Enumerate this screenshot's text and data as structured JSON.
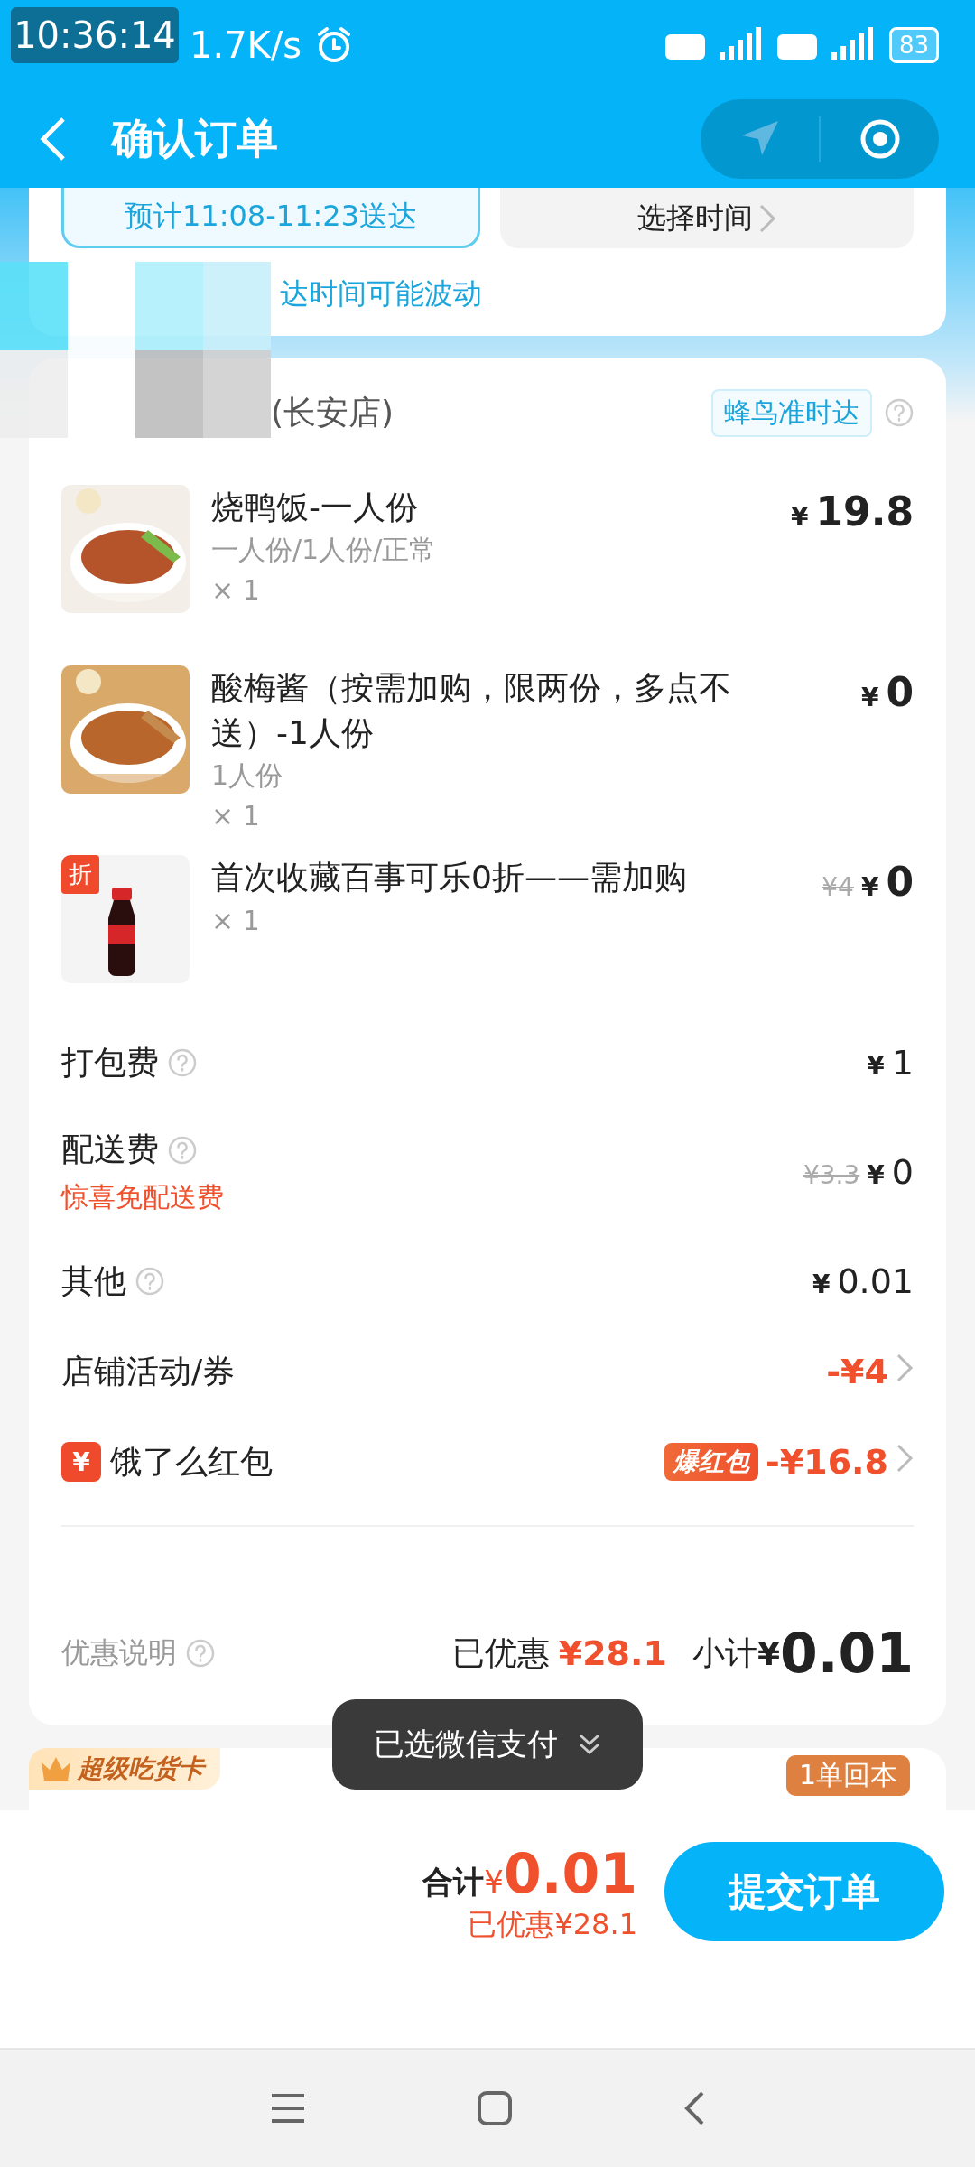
{
  "status_bar": {
    "overlay_time": "10:36:14",
    "speed": "1.7K/s",
    "battery": "83"
  },
  "header": {
    "title": "确认订单"
  },
  "delivery": {
    "options": [
      {
        "label": "预计11:08-11:23送达",
        "selected": true
      },
      {
        "label": "选择时间",
        "selected": false
      }
    ],
    "note": "达时间可能波动"
  },
  "store": {
    "name": "(长安店)",
    "badge": "蜂鸟准时达"
  },
  "items": [
    {
      "name": "烧鸭饭-一人份",
      "spec": "一人份/1人份/正常",
      "qty": "× 1",
      "currency": "¥",
      "price": "19.8"
    },
    {
      "name": "酸梅酱（按需加购，限两份，多点不送）-1人份",
      "spec": "1人份",
      "qty": "× 1",
      "currency": "¥",
      "price": "0"
    },
    {
      "name": "首次收藏百事可乐0折——需加购",
      "qty": "× 1",
      "tag": "折",
      "original_price": "¥4",
      "currency": "¥",
      "price": "0"
    }
  ],
  "fees": [
    {
      "label": "打包费",
      "help": true,
      "currency": "¥",
      "value": "1",
      "discount": false
    },
    {
      "label": "配送费",
      "help": true,
      "note": "惊喜免配送费",
      "original": "¥3.3",
      "currency": "¥",
      "value": "0",
      "discount": false
    },
    {
      "label": "其他",
      "help": true,
      "currency": "¥",
      "value": "0.01",
      "discount": false
    },
    {
      "label": "店铺活动/券",
      "help": false,
      "value": "-¥4",
      "discount": true,
      "arrow": true
    },
    {
      "label": "饿了么红包",
      "help": false,
      "icon": "¥",
      "tag": "爆红包",
      "value": "-¥16.8",
      "discount": true,
      "arrow": true
    }
  ],
  "summary": {
    "link": "优惠说明",
    "saved_label": "已优惠",
    "saved": "¥28.1",
    "subtotal_label": "小计",
    "currency": "¥",
    "subtotal": "0.01"
  },
  "super_card": {
    "badge": "超级吃货卡",
    "tag": "1单回本"
  },
  "toast": {
    "text": "已选微信支付"
  },
  "footer": {
    "total_label": "合计",
    "currency": "¥",
    "total": "0.01",
    "saved": "已优惠¥28.1",
    "submit": "提交订单"
  }
}
